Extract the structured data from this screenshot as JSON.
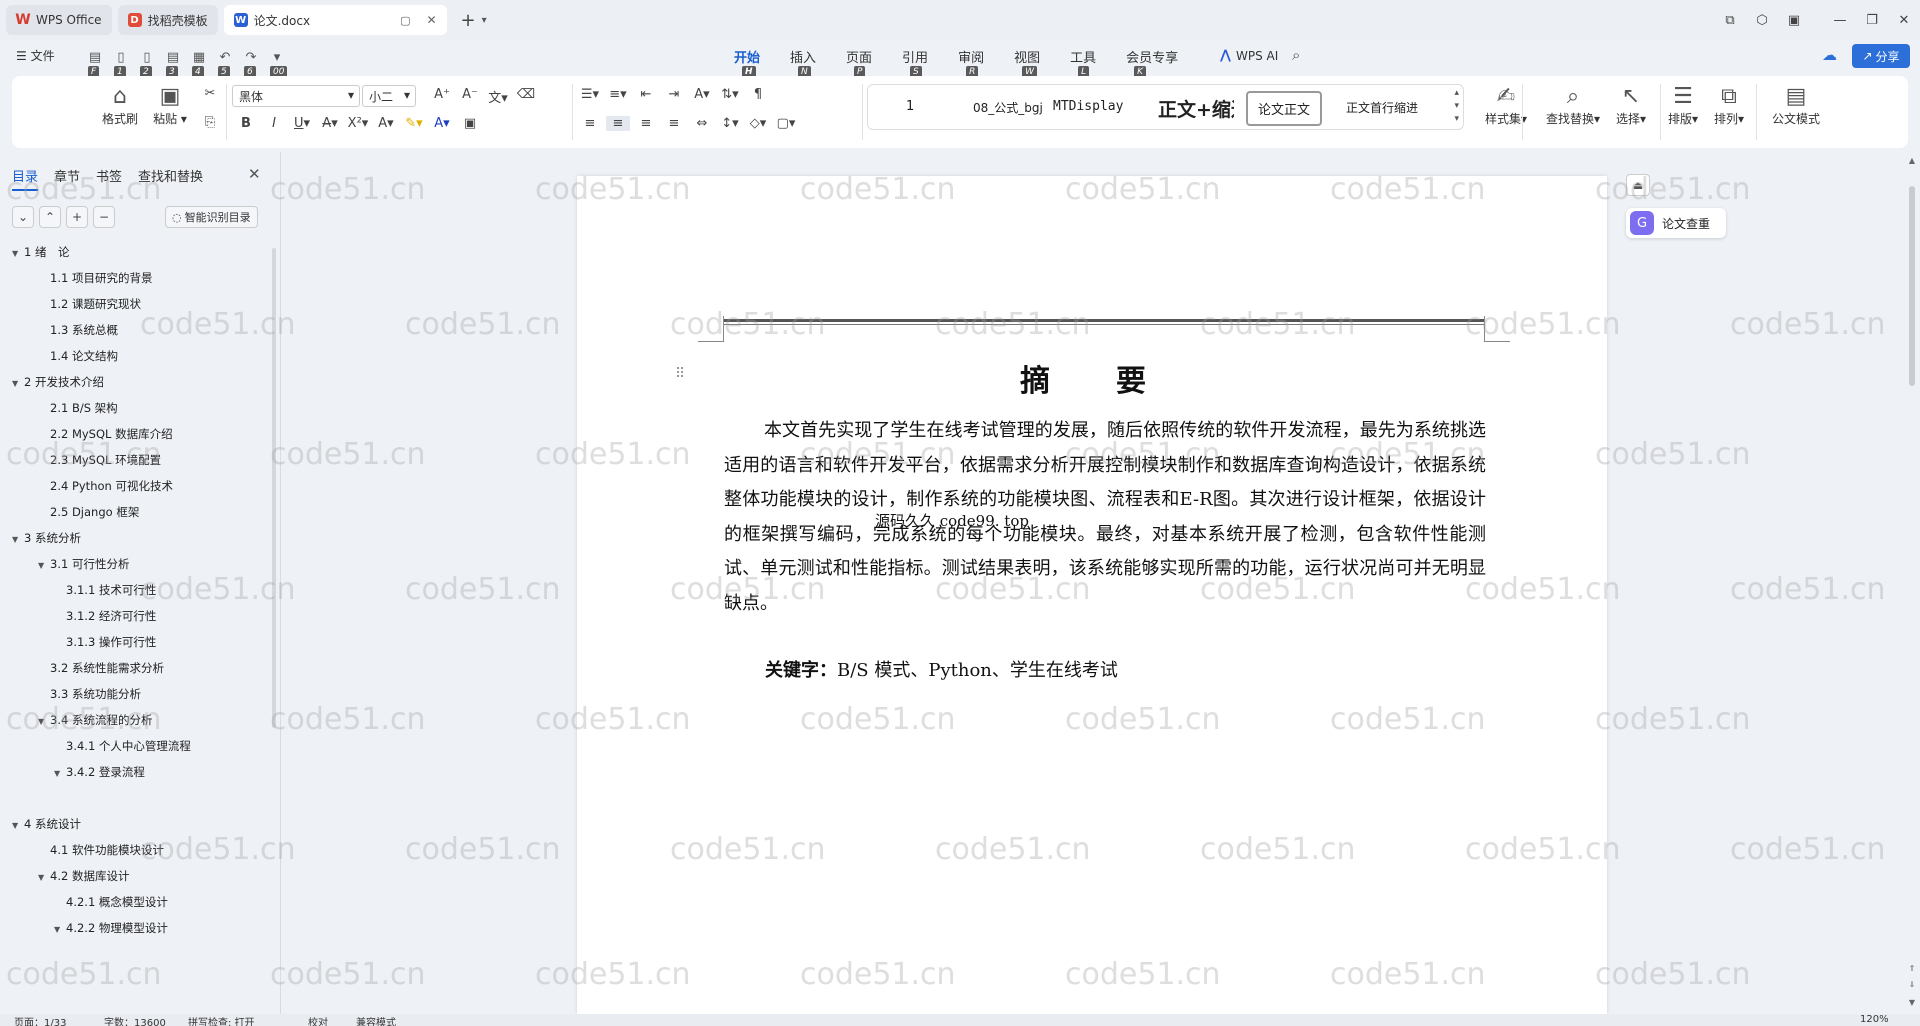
{
  "titlebar": {
    "tabs": [
      {
        "label": "WPS Office",
        "icon": "wps-logo-icon"
      },
      {
        "label": "找稻壳模板",
        "icon": "docer-icon"
      },
      {
        "label": "论文.docx",
        "icon": "word-doc-icon"
      }
    ]
  },
  "menu": {
    "file": "☰ 文件",
    "quick_keytips": [
      "F",
      "1",
      "2",
      "3",
      "4",
      "5",
      "6",
      "00"
    ],
    "tabs": [
      {
        "label": "开始",
        "key": "H"
      },
      {
        "label": "插入",
        "key": "N"
      },
      {
        "label": "页面",
        "key": "P"
      },
      {
        "label": "引用",
        "key": "S"
      },
      {
        "label": "审阅",
        "key": "R"
      },
      {
        "label": "视图",
        "key": "W"
      },
      {
        "label": "工具",
        "key": "L"
      },
      {
        "label": "会员专享",
        "key": "K"
      }
    ],
    "ai": "WPS AI",
    "share": "分享"
  },
  "ribbon": {
    "format_painter": "格式刷",
    "paste": "粘贴",
    "font_name": "黑体",
    "font_size": "小二",
    "styles": [
      "1",
      "08_公式_bgj",
      "MTDisplay",
      "正文+缩进",
      "论文正文",
      "正文首行缩进"
    ],
    "style_set": "样式集",
    "find_replace": "查找替换",
    "select": "选择",
    "layout": "排版",
    "arrange": "排列",
    "official": "公文模式"
  },
  "nav": {
    "tabs": [
      "目录",
      "章节",
      "书签",
      "查找和替换"
    ],
    "smart": "智能识别目录",
    "toc": [
      {
        "label": "1 绪　论",
        "lvl": 0,
        "tri": true
      },
      {
        "label": "1.1 项目研究的背景",
        "lvl": 1
      },
      {
        "label": "1.2 课题研究现状",
        "lvl": 1
      },
      {
        "label": "1.3 系统总概",
        "lvl": 1
      },
      {
        "label": "1.4 论文结构",
        "lvl": 1
      },
      {
        "label": "2 开发技术介绍",
        "lvl": 0,
        "tri": true
      },
      {
        "label": "2.1 B/S 架构",
        "lvl": 1
      },
      {
        "label": "2.2 MySQL 数据库介绍",
        "lvl": 1
      },
      {
        "label": "2.3 MySQL 环境配置",
        "lvl": 1
      },
      {
        "label": "2.4 Python 可视化技术",
        "lvl": 1
      },
      {
        "label": "2.5 Django 框架",
        "lvl": 1
      },
      {
        "label": "3 系统分析",
        "lvl": 0,
        "tri": true
      },
      {
        "label": "3.1 可行性分析",
        "lvl": 1,
        "tri": true
      },
      {
        "label": "3.1.1 技术可行性",
        "lvl": 2
      },
      {
        "label": "3.1.2 经济可行性",
        "lvl": 2
      },
      {
        "label": "3.1.3 操作可行性",
        "lvl": 2
      },
      {
        "label": "3.2 系统性能需求分析",
        "lvl": 1
      },
      {
        "label": "3.3 系统功能分析",
        "lvl": 1
      },
      {
        "label": "3.4 系统流程的分析",
        "lvl": 1,
        "tri": true
      },
      {
        "label": "3.4.1 个人中心管理流程",
        "lvl": 2
      },
      {
        "label": "3.4.2 登录流程",
        "lvl": 2,
        "tri": true
      },
      {
        "label": "4 系统设计",
        "lvl": 0,
        "tri": true
      },
      {
        "label": "4.1 软件功能模块设计",
        "lvl": 1
      },
      {
        "label": "4.2 数据库设计",
        "lvl": 1,
        "tri": true
      },
      {
        "label": "4.2.1 概念模型设计",
        "lvl": 2
      },
      {
        "label": "4.2.2 物理模型设计",
        "lvl": 2,
        "tri": true
      }
    ]
  },
  "document": {
    "title": "摘　要",
    "body": "本文首先实现了学生在线考试管理的发展，随后依照传统的软件开发流程，最先为系统挑选适用的语言和软件开发平台，依据需求分析开展控制模块制作和数据库查询构造设计，依据系统整体功能模块的设计，制作系统的功能模块图、流程表和E-R图。其次进行设计框架，依据设计的框架撰写编码，完成系统的每个功能模块。最终，对基本系统开展了检测，包含软件性能测试、单元测试和性能指标。测试结果表明，该系统能够实现所需的功能，运行状况尚可并无明显缺点。",
    "overlay": "源码久久 code99. top",
    "keywords_label": "关键字：",
    "keywords": "B/S 模式、Python、学生在线考试"
  },
  "side": {
    "plagiarism": "论文查重"
  },
  "watermark": "code51.cn",
  "status": {
    "page": "页面：1/33",
    "words": "字数：13600",
    "spell": "拼写检查: 打开",
    "proof": "校对",
    "compat": "兼容模式",
    "zoom": "120%"
  }
}
